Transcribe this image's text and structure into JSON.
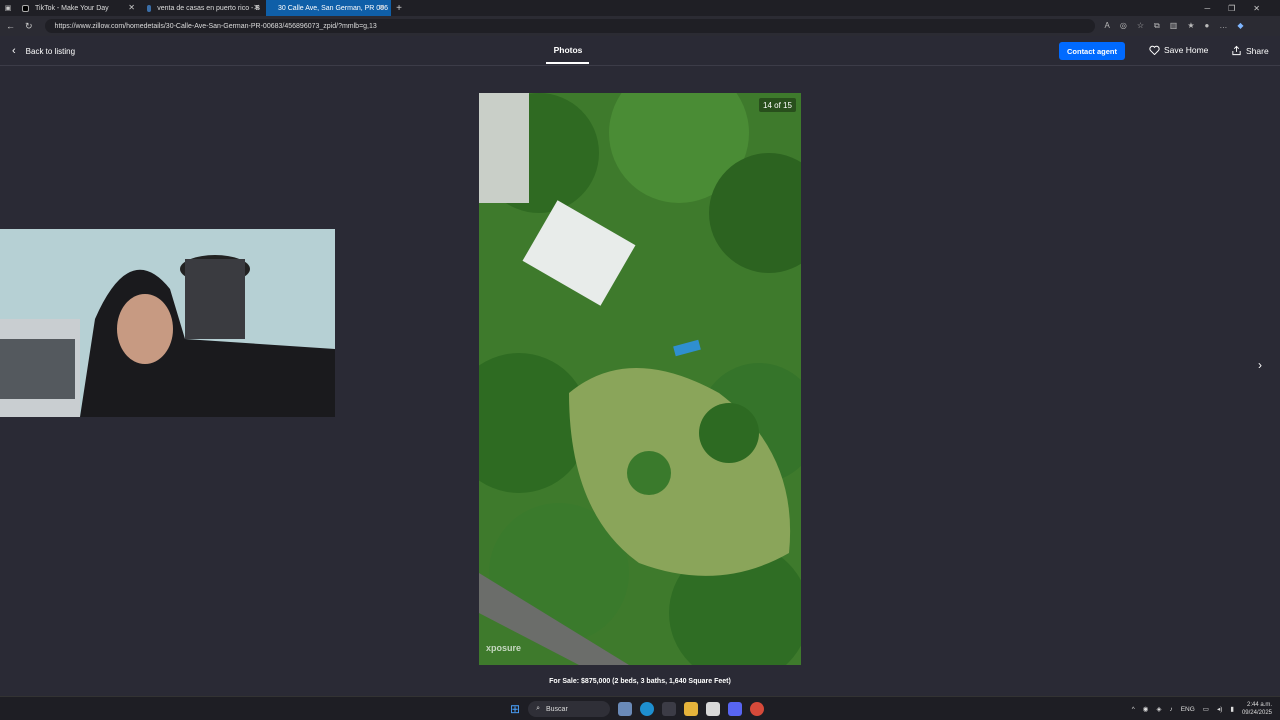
{
  "browser": {
    "tabs": [
      {
        "label": "TikTok - Make Your Day",
        "active": false
      },
      {
        "label": "venta de casas en puerto rico - B",
        "active": false
      },
      {
        "label": "30 Calle Ave, San German, PR 006",
        "active": true
      }
    ],
    "url": "https://www.zillow.com/homedetails/30-Calle-Ave-San-German-PR-00683/456896073_zpid/?mmlb=g,13"
  },
  "header": {
    "back_label": "Back to listing",
    "tab_label": "Photos",
    "contact_label": "Contact agent",
    "save_label": "Save Home",
    "share_label": "Share"
  },
  "gallery": {
    "counter": "14 of 15",
    "watermark": "xposure",
    "caption": "For Sale: $875,000 (2 beds, 3 baths, 1,640 Square Feet)"
  },
  "taskbar": {
    "search_placeholder": "Buscar",
    "lang": "ENG",
    "time": "2:44 a.m.",
    "date": "09/24/2025"
  },
  "colors": {
    "accent": "#006aff",
    "background": "#2a2a35"
  }
}
